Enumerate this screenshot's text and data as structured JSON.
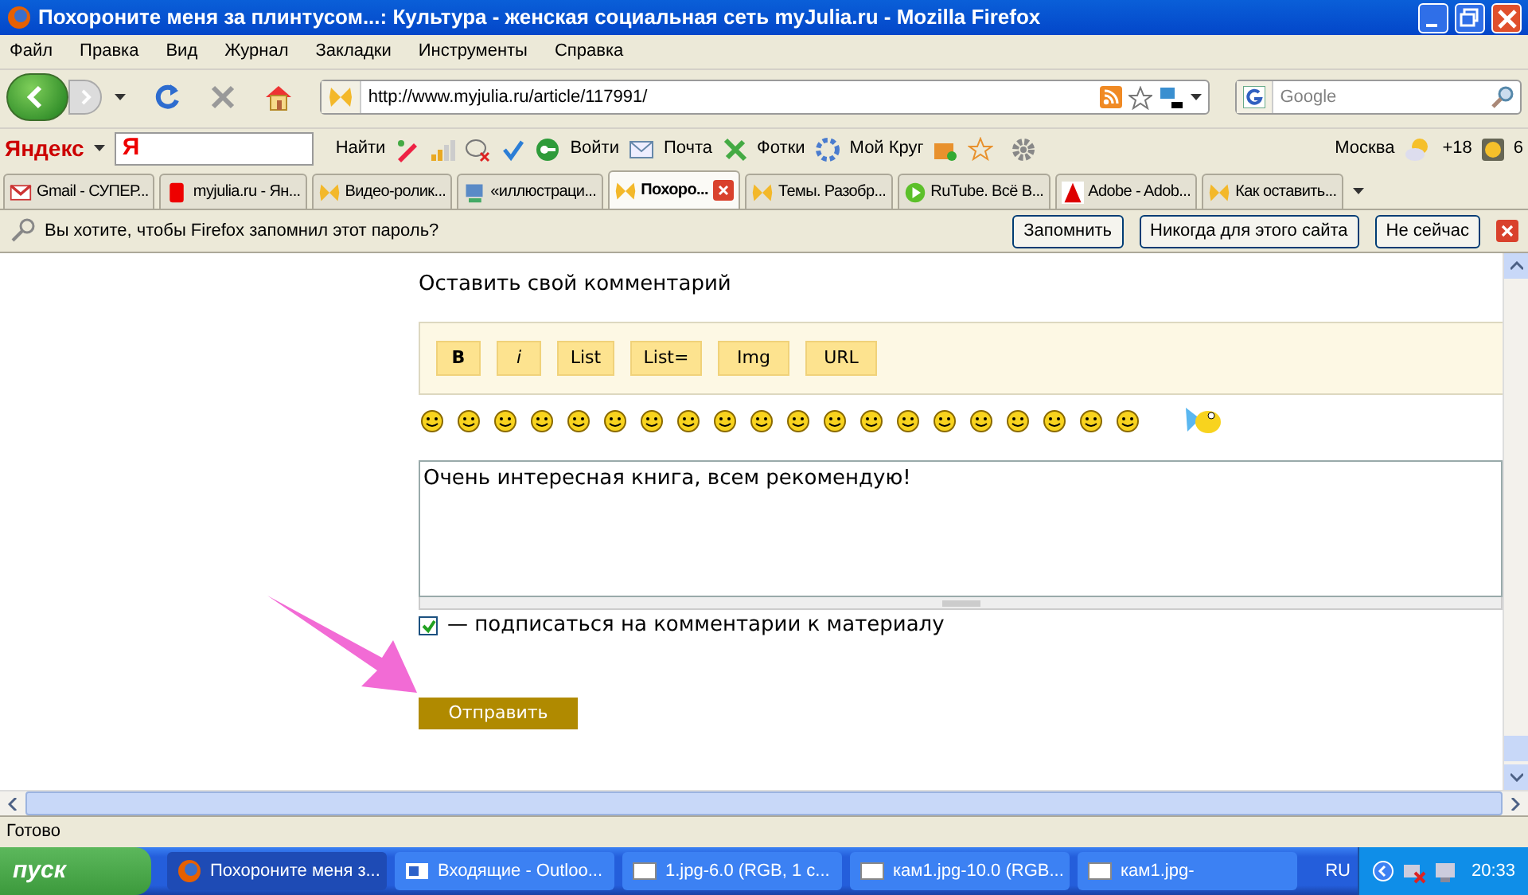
{
  "window": {
    "title": "Похороните меня за плинтусом...: Культура - женская социальная сеть myJulia.ru - Mozilla Firefox"
  },
  "menu": [
    "Файл",
    "Правка",
    "Вид",
    "Журнал",
    "Закладки",
    "Инструменты",
    "Справка"
  ],
  "address_bar": {
    "value": "http://www.myjulia.ru/article/117991/"
  },
  "search_field": {
    "placeholder": "Google"
  },
  "yandex_toolbar": {
    "logo": "Яндекс",
    "search_logo": "Я",
    "find": "Найти",
    "items": [
      "Войти",
      "Почта",
      "Фотки",
      "Мой Круг"
    ],
    "city": "Москва",
    "temperature": "+18",
    "traffic": "6"
  },
  "tabs": [
    {
      "label": "Gmail - СУПЕР...",
      "selected": false
    },
    {
      "label": "myjulia.ru - Ян...",
      "selected": false
    },
    {
      "label": "Видео-ролик...",
      "selected": false
    },
    {
      "label": "«иллюстраци...",
      "selected": false
    },
    {
      "label": "Похоро...",
      "selected": true
    },
    {
      "label": "Темы. Разобр...",
      "selected": false
    },
    {
      "label": "RuTube. Всё В...",
      "selected": false
    },
    {
      "label": "Adobe - Adob...",
      "selected": false
    },
    {
      "label": "Как оставить...",
      "selected": false
    }
  ],
  "password_bar": {
    "message": "Вы хотите, чтобы Firefox запомнил этот пароль?",
    "buttons": [
      "Запомнить",
      "Никогда для этого сайта",
      "Не сейчас"
    ]
  },
  "comment_form": {
    "heading": "Оставить свой комментарий",
    "format_buttons": [
      "B",
      "i",
      "List",
      "List=",
      "Img",
      "URL"
    ],
    "text": "Очень интересная книга, всем рекомендую!",
    "subscribe": {
      "label": "— подписаться на комментарии к материалу",
      "checked": true
    },
    "submit": "Отправить"
  },
  "status_bar": "Готово",
  "taskbar": {
    "start": "пуск",
    "items": [
      "Похороните меня з...",
      "Входящие - Outloo...",
      "1.jpg-6.0 (RGB, 1 c...",
      "кам1.jpg-10.0 (RGB...",
      "кам1.jpg-"
    ],
    "language": "RU",
    "time": "20:33"
  }
}
